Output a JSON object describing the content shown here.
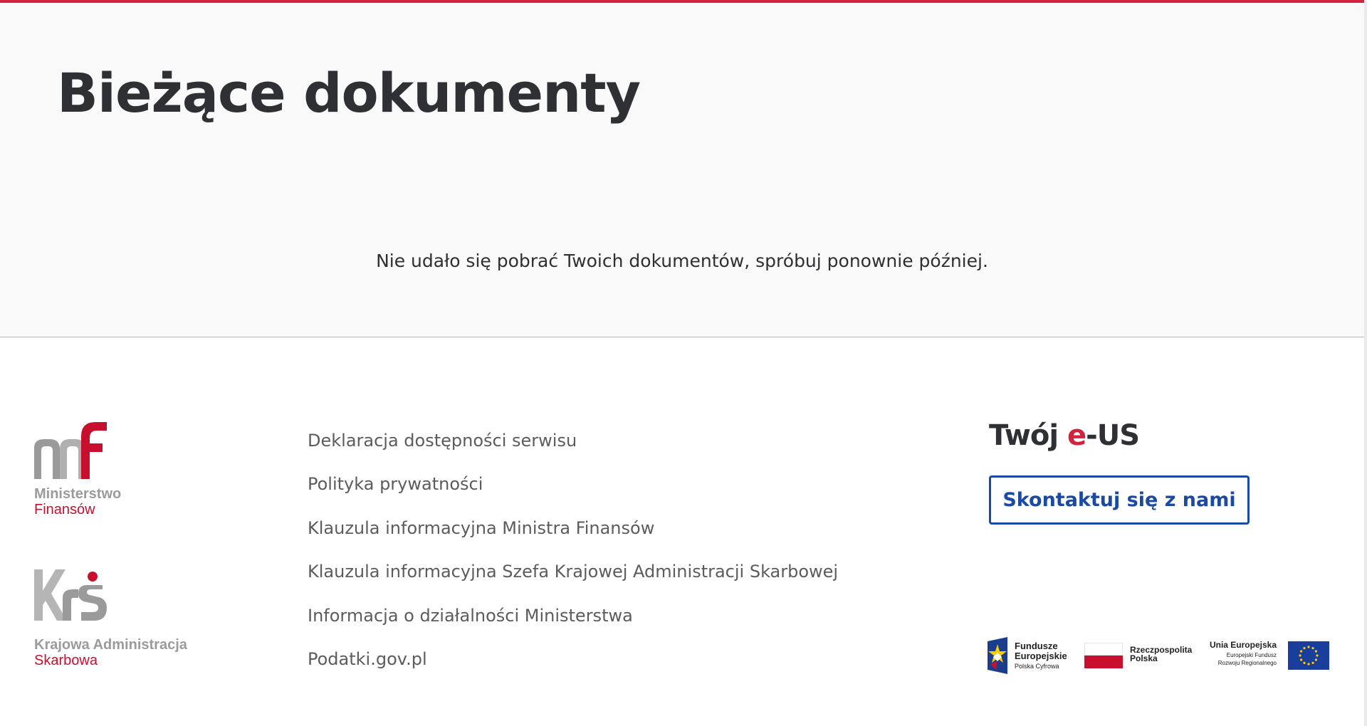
{
  "main": {
    "title": "Bieżące dokumenty",
    "error_message": "Nie udało się pobrać Twoich dokumentów, spróbuj ponownie później."
  },
  "footer": {
    "logos": {
      "mf": {
        "line1": "Ministerstwo",
        "line2": "Finansów"
      },
      "kas": {
        "line1": "Krajowa Administracja",
        "line2": "Skarbowa"
      }
    },
    "links": [
      "Deklaracja dostępności serwisu",
      "Polityka prywatności",
      "Klauzula informacyjna Ministra Finansów",
      "Klauzula informacyjna Szefa Krajowej Administracji Skarbowej",
      "Informacja o działalności Ministerstwa",
      "Podatki.gov.pl"
    ],
    "eus": {
      "prefix": "Twój ",
      "accent": "e",
      "suffix": "-US",
      "contact_label": "Skontaktuj się z nami"
    },
    "eu_logos": {
      "fe_line1": "Fundusze",
      "fe_line2": "Europejskie",
      "fe_line3": "Polska Cyfrowa",
      "rp_line1": "Rzeczpospolita",
      "rp_line2": "Polska",
      "ue_line1": "Unia Europejska",
      "ue_line2": "Europejski Fundusz",
      "ue_line3": "Rozwoju Regionalnego"
    }
  },
  "colors": {
    "accent_red": "#d4213d",
    "link_blue": "#1a4aa3",
    "background": "#f9f9f9"
  }
}
